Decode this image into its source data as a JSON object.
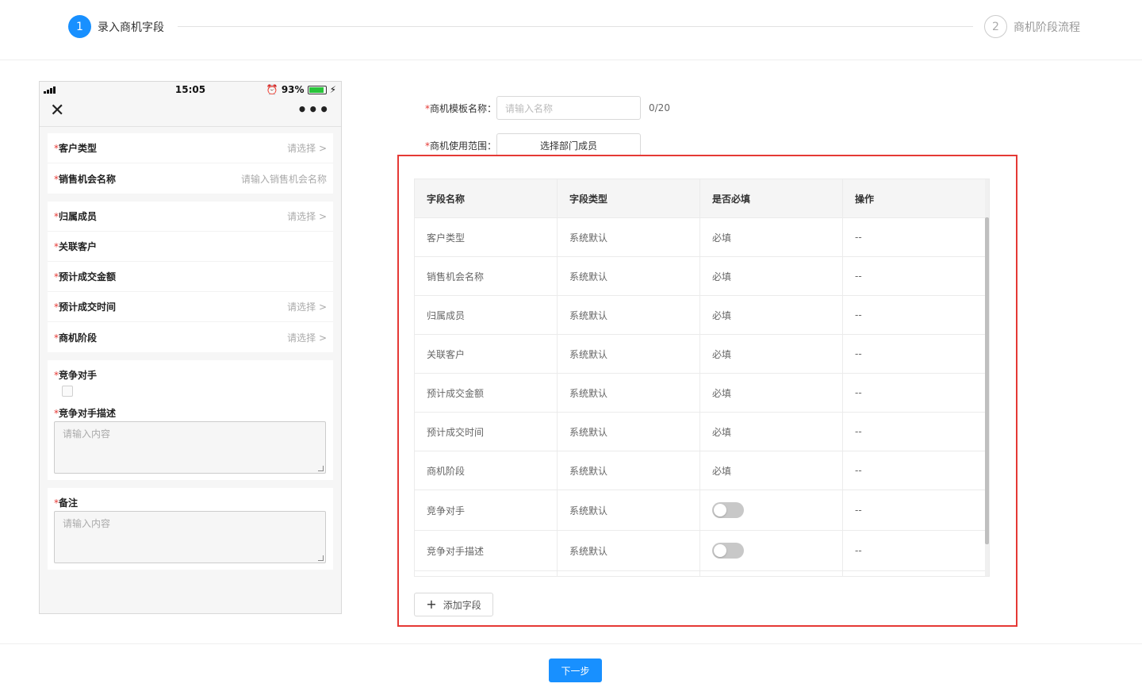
{
  "steps": [
    {
      "number": "1",
      "label": "录入商机字段"
    },
    {
      "number": "2",
      "label": "商机阶段流程"
    }
  ],
  "phone": {
    "time": "15:05",
    "battery": "93%",
    "close_icon": "close-icon",
    "more_icon": "more-icon",
    "groups": [
      [
        {
          "label": "客户类型",
          "hint": "请选择 >"
        },
        {
          "label": "销售机会名称",
          "hint": "请输入销售机会名称"
        }
      ],
      [
        {
          "label": "归属成员",
          "hint": "请选择 >"
        },
        {
          "label": "关联客户",
          "hint": ""
        },
        {
          "label": "预计成交金额",
          "hint": ""
        },
        {
          "label": "预计成交时间",
          "hint": "请选择 >"
        },
        {
          "label": "商机阶段",
          "hint": "请选择 >"
        }
      ]
    ],
    "competitor": {
      "label": "竞争对手"
    },
    "competitor_desc": {
      "label": "竞争对手描述",
      "placeholder": "请输入内容"
    },
    "remark": {
      "label": "备注",
      "placeholder": "请输入内容"
    }
  },
  "form": {
    "name_label": "商机模板名称：",
    "name_placeholder": "请输入名称",
    "name_counter": "0/20",
    "scope_label": "商机使用范围：",
    "scope_button": "选择部门成员"
  },
  "table": {
    "headers": [
      "字段名称",
      "字段类型",
      "是否必填",
      "操作"
    ],
    "rows": [
      {
        "name": "客户类型",
        "type": "系统默认",
        "required": "必填",
        "action": "--"
      },
      {
        "name": "销售机会名称",
        "type": "系统默认",
        "required": "必填",
        "action": "--"
      },
      {
        "name": "归属成员",
        "type": "系统默认",
        "required": "必填",
        "action": "--"
      },
      {
        "name": "关联客户",
        "type": "系统默认",
        "required": "必填",
        "action": "--"
      },
      {
        "name": "预计成交金额",
        "type": "系统默认",
        "required": "必填",
        "action": "--"
      },
      {
        "name": "预计成交时间",
        "type": "系统默认",
        "required": "必填",
        "action": "--"
      },
      {
        "name": "商机阶段",
        "type": "系统默认",
        "required": "必填",
        "action": "--"
      },
      {
        "name": "竞争对手",
        "type": "系统默认",
        "required_toggle": false,
        "action": "--"
      },
      {
        "name": "竞争对手描述",
        "type": "系统默认",
        "required_toggle": false,
        "action": "--"
      }
    ],
    "add_button": "添加字段"
  },
  "next_button": "下一步",
  "colors": {
    "primary": "#1890ff",
    "highlight_border": "#e53935",
    "required_star": "#e53935"
  }
}
